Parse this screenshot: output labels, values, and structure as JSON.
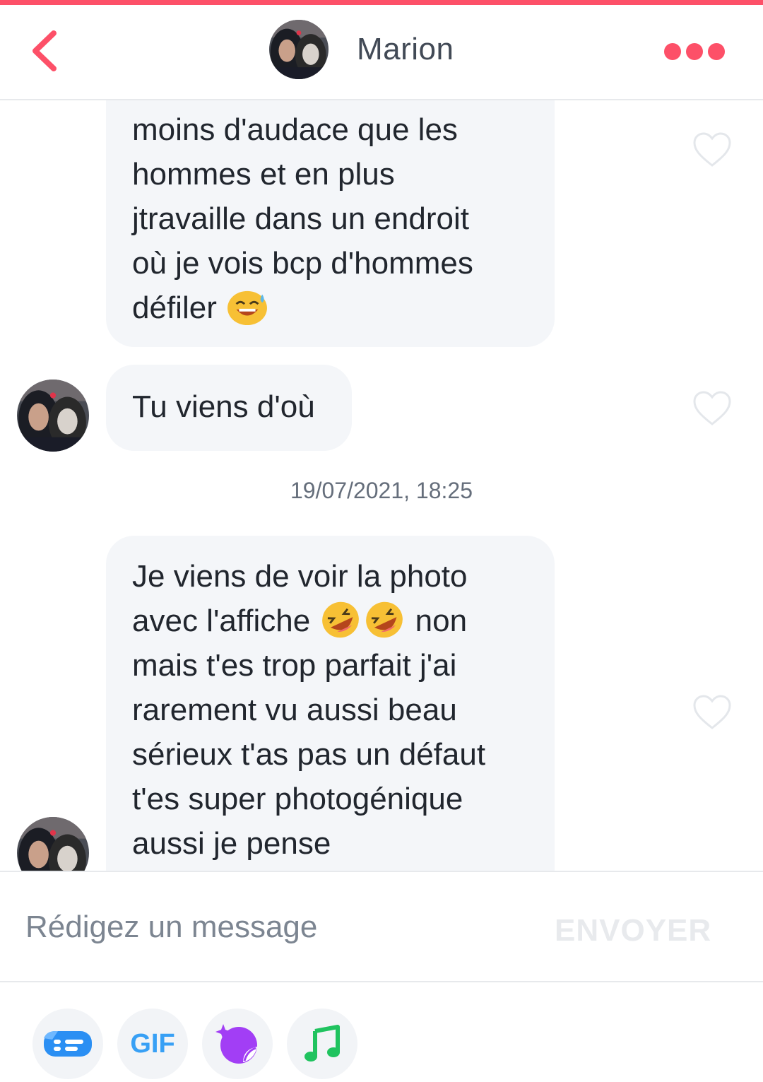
{
  "header": {
    "contact_name": "Marion",
    "back_icon": "chevron-left-icon",
    "more_icon": "more-dots-icon"
  },
  "messages": [
    {
      "lines": [
        "moins d'audace que les",
        "hommes et en plus",
        "jtravaille dans un endroit",
        "où je vois bcp d'hommes",
        "défiler"
      ],
      "emoji": "smiling-sweat-emoji",
      "liked": false
    },
    {
      "lines": [
        "Tu viens d'où"
      ],
      "liked": false
    },
    {
      "lines": [
        "Je viens de voir la photo",
        "avec l'affiche",
        "non",
        "mais t'es trop parfait j'ai",
        "rarement vu aussi beau",
        "sérieux t'as pas un défaut",
        "t'es super photogénique",
        "aussi je pense"
      ],
      "emoji": "rolling-on-floor-laughing-emoji",
      "liked": false
    }
  ],
  "timestamp": "19/07/2021, 18:25",
  "composer": {
    "placeholder": "Rédigez un message",
    "value": "",
    "send_label": "ENVOYER"
  },
  "toolbar": {
    "gif_label": "GIF",
    "icons": [
      "card-icon",
      "gif-icon",
      "sparkle-sticker-icon",
      "music-note-icon"
    ]
  },
  "colors": {
    "brand": "#fd5068",
    "bubble": "#f4f6f9",
    "gif_blue": "#38a0f5",
    "sticker_purple": "#a23ef5",
    "music_green": "#20c35f"
  }
}
